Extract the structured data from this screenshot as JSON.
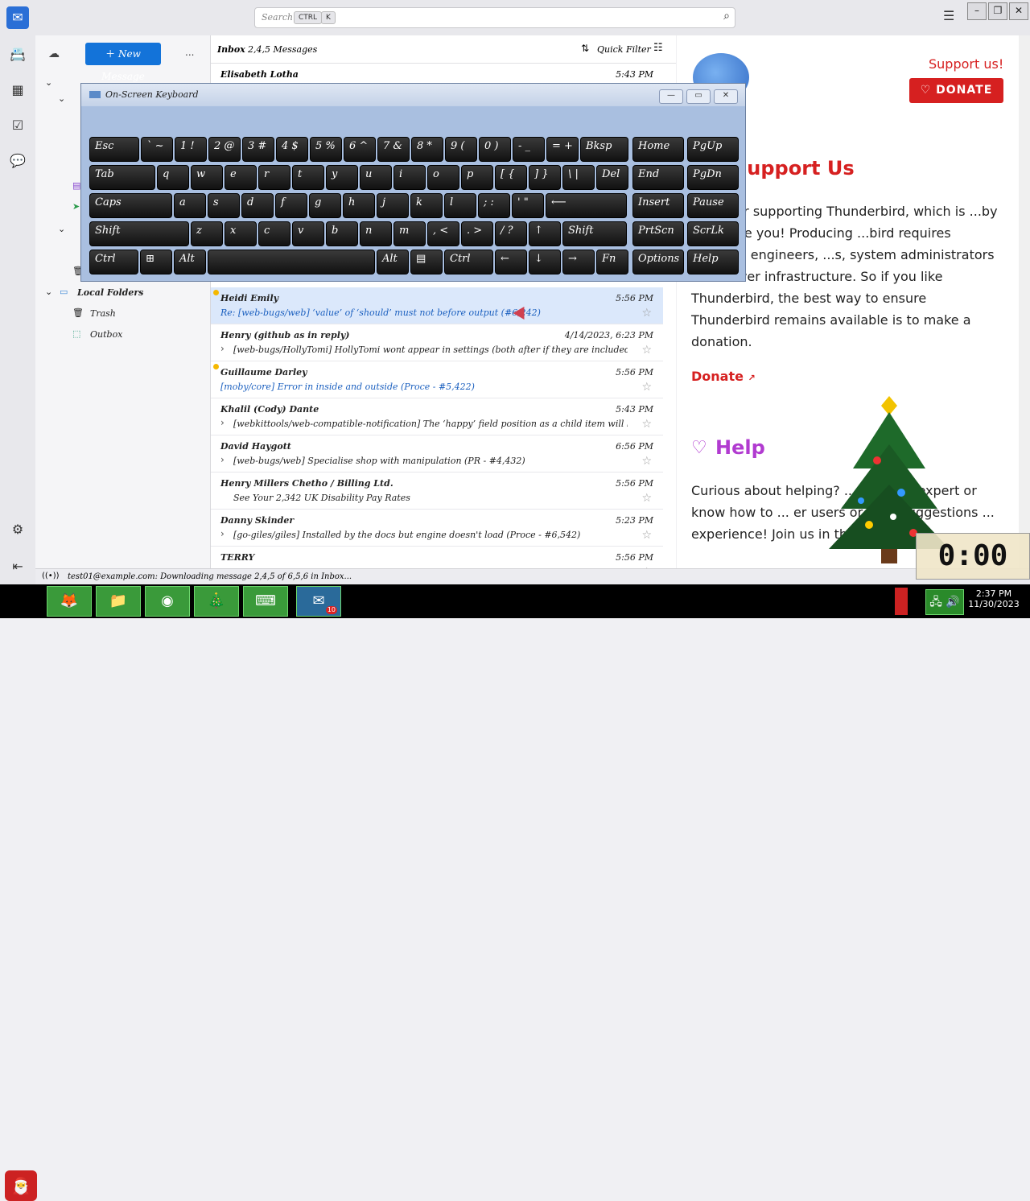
{
  "topbar": {
    "search_placeholder": "Search...",
    "kbd_ctrl": "CTRL",
    "kbd_k": "K"
  },
  "folders": {
    "new_message_label": "New Message",
    "more_label": "...",
    "local_folders_label": "Local Folders",
    "trash_label": "Trash",
    "outbox_label": "Outbox"
  },
  "list": {
    "header_title": "Inbox",
    "header_count": "2,4,5 Messages",
    "quick_filter_label": "Quick Filter",
    "first_row_sender": "Elisabeth Lotha",
    "first_row_date": "5:43 PM",
    "messages": [
      {
        "sender": "Heidi Emily",
        "subject": "Re: [web-bugs/web] ‘value’ of ‘should’ must not before output (#6,242)",
        "date": "5:56 PM",
        "unread": true,
        "selected": true,
        "has_thread": false
      },
      {
        "sender": "Henry (github as in reply)",
        "subject": "[web-bugs/HollyTomi] HollyTomi wont appear in settings (both after if they are included in web applications) (Proce...",
        "date": "4/14/2023, 6:23 PM",
        "unread": false,
        "selected": false,
        "has_thread": true
      },
      {
        "sender": "Guillaume Darley",
        "subject": "[moby/core] Error in inside and outside (Proce - #5,422)",
        "date": "5:56 PM",
        "unread": true,
        "selected": false,
        "has_thread": false
      },
      {
        "sender": "Khalil (Cody) Dante",
        "subject": "[webkittools/web-compatible-notification] The ‘happy’ field position as a child item will be ignored. (Proce - #4,332)",
        "date": "5:43 PM",
        "unread": false,
        "selected": false,
        "has_thread": true
      },
      {
        "sender": "David Haygott",
        "subject": "[web-bugs/web] Specialise shop with manipulation (PR - #4,432)",
        "date": "6:56 PM",
        "unread": false,
        "selected": false,
        "has_thread": true
      },
      {
        "sender": "Henry Millers Chetho / Billing Ltd.",
        "subject": "See Your 2,342 UK Disability Pay Rates",
        "date": "5:56 PM",
        "unread": false,
        "selected": false,
        "has_thread": false
      },
      {
        "sender": "Danny Skinder",
        "subject": "[go-giles/giles] Installed by the docs but engine doesn't load (Proce - #6,542)",
        "date": "5:23 PM",
        "unread": false,
        "selected": false,
        "has_thread": true
      },
      {
        "sender": "TERRY",
        "subject": "",
        "date": "5:56 PM",
        "unread": false,
        "selected": false,
        "has_thread": false
      }
    ]
  },
  "right": {
    "support_link": "Support us!",
    "donate_button": "DONATE",
    "support_title": "Support Us",
    "support_text": "...you for supporting Thunderbird, which is ...by users like you! Producing ...bird requires software engineers, ...s, system administrators and server infrastructure. So if you like Thunderbird, the best way to ensure Thunderbird remains available is to make a donation.",
    "donate_link": "Donate",
    "help_title": "Help",
    "help_text": "Curious about helping? ... to be an expert or know how to ... er users or offer suggestions ... experience! Join us in th..."
  },
  "statusbar": {
    "text": "test01@example.com: Downloading message 2,4,5 of 6,5,6 in Inbox..."
  },
  "taskbar": {
    "time": "2:37 PM",
    "date": "11/30/2023",
    "badge": "10"
  },
  "osk": {
    "title": "On-Screen Keyboard",
    "rows": [
      [
        {
          "label": "Esc",
          "w": 62
        },
        {
          "label": "` ~",
          "w": 40
        },
        {
          "label": "1 !",
          "w": 40
        },
        {
          "label": "2 @",
          "w": 40
        },
        {
          "label": "3 #",
          "w": 40
        },
        {
          "label": "4 $",
          "w": 40
        },
        {
          "label": "5 %",
          "w": 40
        },
        {
          "label": "6 ^",
          "w": 40
        },
        {
          "label": "7 &",
          "w": 40
        },
        {
          "label": "8 *",
          "w": 40
        },
        {
          "label": "9 (",
          "w": 40
        },
        {
          "label": "0 )",
          "w": 40
        },
        {
          "label": "- _",
          "w": 40
        },
        {
          "label": "= +",
          "w": 40
        },
        {
          "label": "Bksp",
          "w": 60
        }
      ],
      [
        {
          "label": "Tab",
          "w": 82
        },
        {
          "label": "q",
          "w": 40
        },
        {
          "label": "w",
          "w": 40
        },
        {
          "label": "e",
          "w": 40
        },
        {
          "label": "r",
          "w": 40
        },
        {
          "label": "t",
          "w": 40
        },
        {
          "label": "y",
          "w": 40
        },
        {
          "label": "u",
          "w": 40
        },
        {
          "label": "i",
          "w": 40
        },
        {
          "label": "o",
          "w": 40
        },
        {
          "label": "p",
          "w": 40
        },
        {
          "label": "[ {",
          "w": 40
        },
        {
          "label": "] }",
          "w": 40
        },
        {
          "label": "\\ |",
          "w": 40
        },
        {
          "label": "Del",
          "w": 40
        }
      ],
      [
        {
          "label": "Caps",
          "w": 103
        },
        {
          "label": "a",
          "w": 40
        },
        {
          "label": "s",
          "w": 40
        },
        {
          "label": "d",
          "w": 40
        },
        {
          "label": "f",
          "w": 40
        },
        {
          "label": "g",
          "w": 40
        },
        {
          "label": "h",
          "w": 40
        },
        {
          "label": "j",
          "w": 40
        },
        {
          "label": "k",
          "w": 40
        },
        {
          "label": "l",
          "w": 40
        },
        {
          "label": "; :",
          "w": 40
        },
        {
          "label": "' \"",
          "w": 40
        },
        {
          "label": "⟵",
          "w": 101
        }
      ],
      [
        {
          "label": "Shift",
          "w": 124
        },
        {
          "label": "z",
          "w": 40
        },
        {
          "label": "x",
          "w": 40
        },
        {
          "label": "c",
          "w": 40
        },
        {
          "label": "v",
          "w": 40
        },
        {
          "label": "b",
          "w": 40
        },
        {
          "label": "n",
          "w": 40
        },
        {
          "label": "m",
          "w": 40
        },
        {
          "label": ", <",
          "w": 40
        },
        {
          "label": ". >",
          "w": 40
        },
        {
          "label": "/ ?",
          "w": 40
        },
        {
          "label": "↑",
          "w": 40
        },
        {
          "label": "Shift",
          "w": 80
        }
      ],
      [
        {
          "label": "Ctrl",
          "w": 61
        },
        {
          "label": "⊞",
          "w": 40
        },
        {
          "label": "Alt",
          "w": 40
        },
        {
          "label": "",
          "w": 208
        },
        {
          "label": "Alt",
          "w": 40
        },
        {
          "label": "▤",
          "w": 40
        },
        {
          "label": "Ctrl",
          "w": 61
        },
        {
          "label": "←",
          "w": 40
        },
        {
          "label": "↓",
          "w": 40
        },
        {
          "label": "→",
          "w": 40
        },
        {
          "label": "Fn",
          "w": 40
        }
      ]
    ],
    "nav_keys": [
      [
        "Home",
        "PgUp"
      ],
      [
        "End",
        "PgDn"
      ],
      [
        "Insert",
        "Pause"
      ],
      [
        "PrtScn",
        "ScrLk"
      ],
      [
        "Options",
        "Help"
      ]
    ]
  },
  "clock_widget": "0:00"
}
